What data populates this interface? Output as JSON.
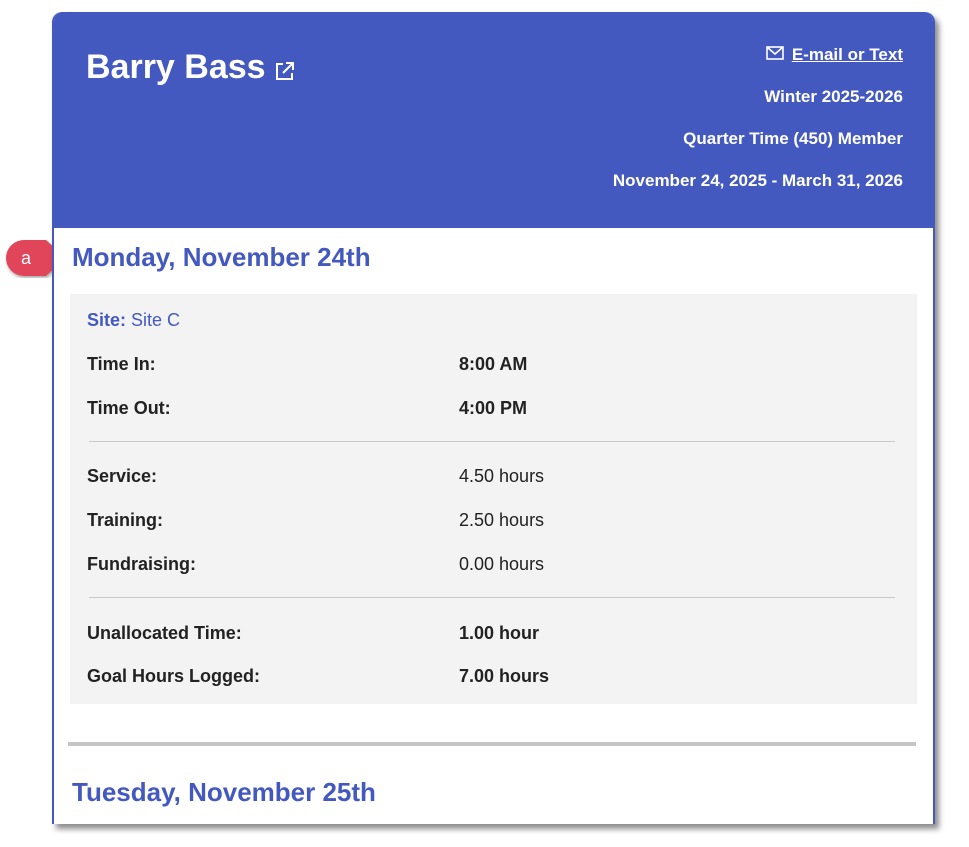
{
  "header": {
    "name": "Barry Bass",
    "contact_label": "E-mail or Text",
    "season": "Winter 2025-2026",
    "membership": "Quarter Time (450) Member",
    "date_range": "November 24, 2025 - March 31, 2026"
  },
  "callout": {
    "label": "a"
  },
  "days": [
    {
      "title": "Monday, November 24th",
      "site_label": "Site:",
      "site_value": "Site C",
      "time_rows": [
        {
          "label": "Time In:",
          "value": "8:00 AM"
        },
        {
          "label": "Time Out:",
          "value": "4:00 PM"
        }
      ],
      "hour_rows": [
        {
          "label": "Service:",
          "value": "4.50 hours"
        },
        {
          "label": "Training:",
          "value": "2.50 hours"
        },
        {
          "label": "Fundraising:",
          "value": "0.00 hours"
        }
      ],
      "total_rows": [
        {
          "label": "Unallocated Time:",
          "value": "1.00 hour"
        },
        {
          "label": "Goal Hours Logged:",
          "value": "7.00 hours"
        }
      ]
    },
    {
      "title": "Tuesday, November 25th"
    }
  ],
  "colors": {
    "accent": "#4459c0",
    "callout": "#e0455a",
    "panel": "#f3f3f3"
  },
  "icons": [
    "external-link-icon",
    "envelope-icon"
  ]
}
